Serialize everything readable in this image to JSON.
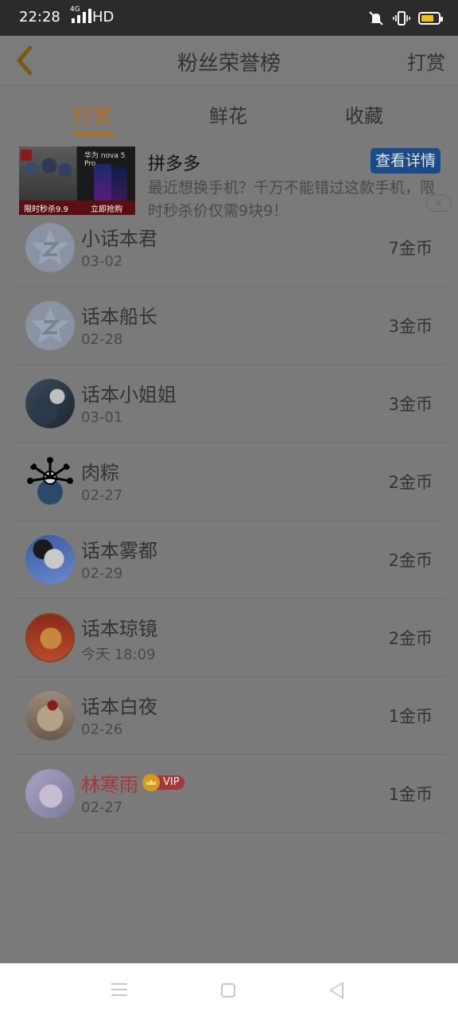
{
  "status_bar": {
    "time": "22:28",
    "network": "4G",
    "hd": "HD"
  },
  "header": {
    "title": "粉丝荣誉榜",
    "right_action": "打赏"
  },
  "tabs": [
    {
      "label": "打赏",
      "active": true
    },
    {
      "label": "鲜花",
      "active": false
    },
    {
      "label": "收藏",
      "active": false
    }
  ],
  "ad": {
    "advertiser": "拼多多",
    "cta": "查看详情",
    "description": "最近想换手机？千万不能错过这款手机，限时秒杀价仅需9块9！",
    "image_brand": "华为 nova 5 Pro",
    "image_banner_left": "限时秒杀9.9",
    "image_banner_right": "立即抢购"
  },
  "fans": [
    {
      "name": "小话本君",
      "date": "03-02",
      "coins": "7金币",
      "avatar": "default-star-avatar"
    },
    {
      "name": "话本船长",
      "date": "02-28",
      "coins": "3金币",
      "avatar": "default-star-avatar"
    },
    {
      "name": "话本小姐姐",
      "date": "03-01",
      "coins": "3金币",
      "avatar": "photo-avatar"
    },
    {
      "name": "肉粽",
      "date": "02-27",
      "coins": "2金币",
      "avatar": "photo-avatar"
    },
    {
      "name": "话本雾都",
      "date": "02-29",
      "coins": "2金币",
      "avatar": "photo-avatar"
    },
    {
      "name": "话本琼镜",
      "date": "今天 18:09",
      "coins": "2金币",
      "avatar": "photo-avatar"
    },
    {
      "name": "话本白夜",
      "date": "02-26",
      "coins": "1金币",
      "avatar": "photo-avatar"
    },
    {
      "name": "林寒雨",
      "date": "02-27",
      "coins": "1金币",
      "avatar": "photo-avatar",
      "vip": "VIP",
      "name_color": "#a63737"
    }
  ],
  "colors": {
    "accent": "#b56d10",
    "dim_overlay": "#7a7a7a",
    "vip_red": "#a63737"
  }
}
